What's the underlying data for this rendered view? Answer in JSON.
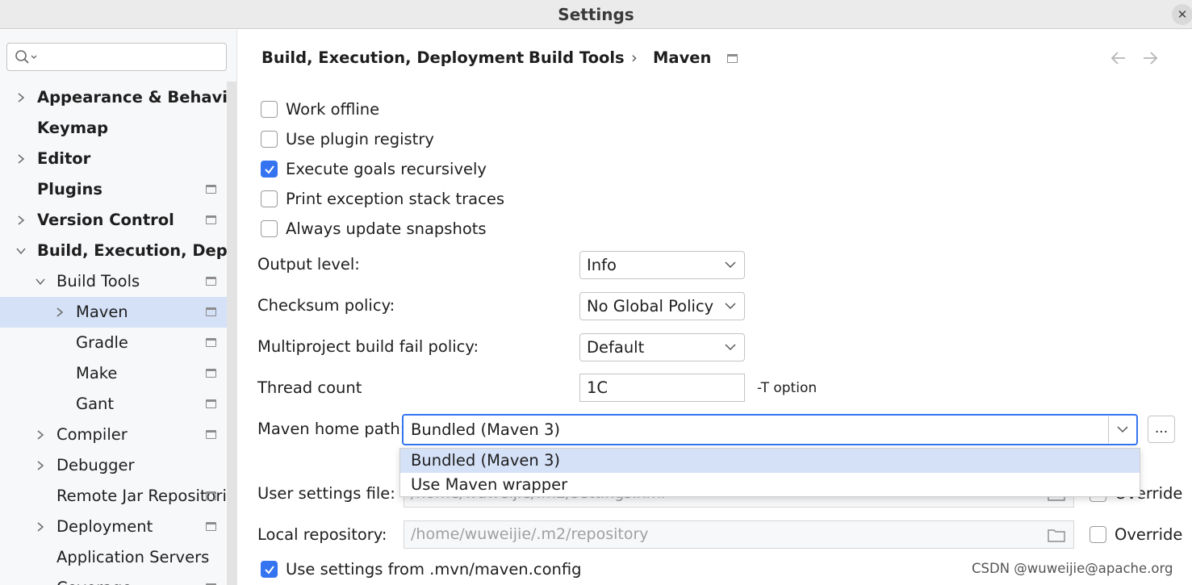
{
  "window": {
    "title": "Settings",
    "close_icon": "close-icon"
  },
  "search": {
    "placeholder": "",
    "icon": "search-icon"
  },
  "sidebar": {
    "items": [
      {
        "label": "Appearance & Behavior",
        "bold": true,
        "expandable": true,
        "expanded": false,
        "indent": 0,
        "project_icon": false
      },
      {
        "label": "Keymap",
        "bold": true,
        "expandable": false,
        "indent": 0,
        "project_icon": false
      },
      {
        "label": "Editor",
        "bold": true,
        "expandable": true,
        "expanded": false,
        "indent": 0,
        "project_icon": false
      },
      {
        "label": "Plugins",
        "bold": true,
        "expandable": false,
        "indent": 0,
        "project_icon": true
      },
      {
        "label": "Version Control",
        "bold": true,
        "expandable": true,
        "expanded": false,
        "indent": 0,
        "project_icon": true
      },
      {
        "label": "Build, Execution, Deployment",
        "bold": true,
        "expandable": true,
        "expanded": true,
        "indent": 0,
        "project_icon": false
      },
      {
        "label": "Build Tools",
        "bold": false,
        "expandable": true,
        "expanded": true,
        "indent": 1,
        "project_icon": true
      },
      {
        "label": "Maven",
        "bold": false,
        "expandable": true,
        "expanded": false,
        "indent": 2,
        "project_icon": true,
        "selected": true
      },
      {
        "label": "Gradle",
        "bold": false,
        "expandable": false,
        "indent": 2,
        "project_icon": true
      },
      {
        "label": "Make",
        "bold": false,
        "expandable": false,
        "indent": 2,
        "project_icon": true
      },
      {
        "label": "Gant",
        "bold": false,
        "expandable": false,
        "indent": 2,
        "project_icon": true
      },
      {
        "label": "Compiler",
        "bold": false,
        "expandable": true,
        "expanded": false,
        "indent": 1,
        "project_icon": true
      },
      {
        "label": "Debugger",
        "bold": false,
        "expandable": true,
        "expanded": false,
        "indent": 1,
        "project_icon": false
      },
      {
        "label": "Remote Jar Repositories",
        "bold": false,
        "expandable": false,
        "indent": 1,
        "project_icon": true
      },
      {
        "label": "Deployment",
        "bold": false,
        "expandable": true,
        "expanded": false,
        "indent": 1,
        "project_icon": true
      },
      {
        "label": "Application Servers",
        "bold": false,
        "expandable": false,
        "indent": 1,
        "project_icon": false
      },
      {
        "label": "Coverage",
        "bold": false,
        "expandable": false,
        "indent": 1,
        "project_icon": true
      }
    ]
  },
  "breadcrumb": {
    "parts": [
      "Build, Execution, Deployment",
      "Build Tools",
      "Maven"
    ],
    "separator": "›"
  },
  "nav": {
    "back_icon": "arrow-left-icon",
    "forward_icon": "arrow-right-icon"
  },
  "checkboxes": [
    {
      "label": "Work offline",
      "checked": false
    },
    {
      "label": "Use plugin registry",
      "checked": false
    },
    {
      "label": "Execute goals recursively",
      "checked": true
    },
    {
      "label": "Print exception stack traces",
      "checked": false
    },
    {
      "label": "Always update snapshots",
      "checked": false
    }
  ],
  "form": {
    "output_level": {
      "label": "Output level:",
      "value": "Info"
    },
    "checksum_policy": {
      "label": "Checksum policy:",
      "value": "No Global Policy"
    },
    "multiproject_fail_policy": {
      "label": "Multiproject build fail policy:",
      "value": "Default"
    },
    "thread_count": {
      "label": "Thread count",
      "value": "1C",
      "hint": "-T option"
    },
    "maven_home": {
      "label": "Maven home path:",
      "value": "Bundled (Maven 3)",
      "browse_label": "..."
    },
    "user_settings": {
      "label": "User settings file:",
      "value": "/home/wuweijie/.m2/settings.xml",
      "override_label": "Override",
      "override_checked": false
    },
    "local_repository": {
      "label": "Local repository:",
      "value": "/home/wuweijie/.m2/repository",
      "override_label": "Override",
      "override_checked": false
    },
    "use_mvn_config": {
      "label": "Use settings from .mvn/maven.config",
      "checked": true
    }
  },
  "dropdown": {
    "options": [
      "Bundled (Maven 3)",
      "Use Maven wrapper"
    ],
    "highlighted": "Bundled (Maven 3)"
  },
  "watermark": "CSDN @wuweijie@apache.org",
  "colors": {
    "accent": "#3574f0",
    "selection": "#d5e1f7",
    "sidebar_bg": "#f7f8fa"
  }
}
